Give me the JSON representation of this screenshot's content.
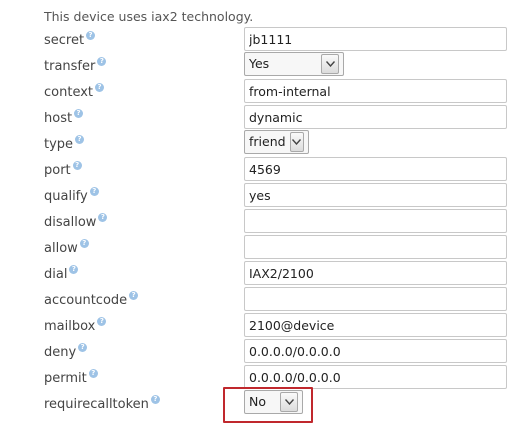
{
  "intro": "This device uses iax2 technology.",
  "help_glyph": "?",
  "fields": {
    "secret": {
      "label": "secret",
      "value": "jb1111"
    },
    "transfer": {
      "label": "transfer",
      "value": "Yes"
    },
    "context": {
      "label": "context",
      "value": "from-internal"
    },
    "host": {
      "label": "host",
      "value": "dynamic"
    },
    "type": {
      "label": "type",
      "value": "friend"
    },
    "port": {
      "label": "port",
      "value": "4569"
    },
    "qualify": {
      "label": "qualify",
      "value": "yes"
    },
    "disallow": {
      "label": "disallow",
      "value": ""
    },
    "allow": {
      "label": "allow",
      "value": ""
    },
    "dial": {
      "label": "dial",
      "value": "IAX2/2100"
    },
    "accountcode": {
      "label": "accountcode",
      "value": ""
    },
    "mailbox": {
      "label": "mailbox",
      "value": "2100@device"
    },
    "deny": {
      "label": "deny",
      "value": "0.0.0.0/0.0.0.0"
    },
    "permit": {
      "label": "permit",
      "value": "0.0.0.0/0.0.0.0"
    },
    "requirecalltoken": {
      "label": "requirecalltoken",
      "value": "No"
    }
  },
  "colors": {
    "highlight": "#c0282d",
    "help_icon": "#9ec3e6"
  }
}
